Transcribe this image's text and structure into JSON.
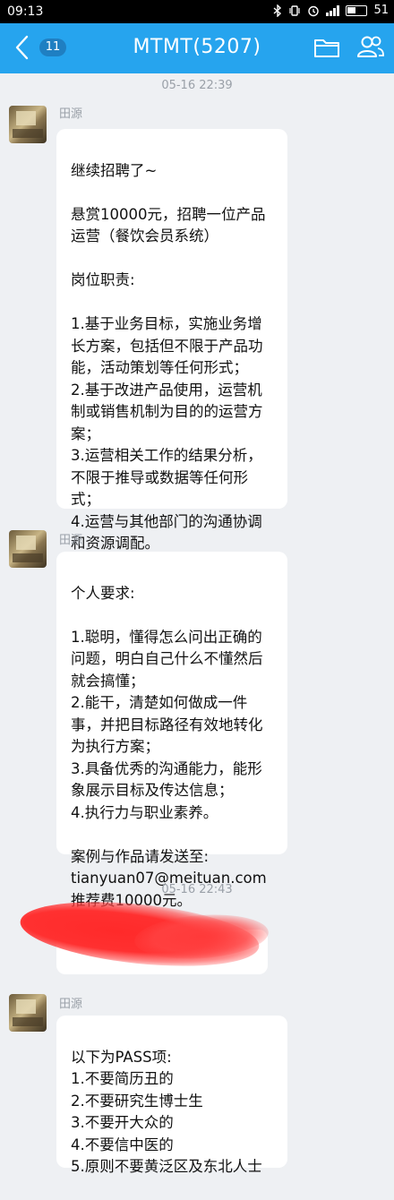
{
  "status_bar": {
    "time": "09:13",
    "battery": "51"
  },
  "header": {
    "back_badge": "11",
    "title": "MTMT(5207)",
    "folder_icon": "folder-icon",
    "members_icon": "people-icon",
    "accent": "#26a4ee"
  },
  "messages": [
    {
      "timestamp": "05-16 22:39"
    },
    {
      "sender": "田源",
      "text": "继续招聘了~\n\n悬赏10000元，招聘一位产品运营（餐饮会员系统）\n\n岗位职责:\n\n1.基于业务目标，实施业务增长方案，包括但不限于产品功能，活动策划等任何形式；\n2.基于改进产品使用，运营机制或销售机制为目的的运营方案；\n3.运营相关工作的结果分析，不限于推导或数据等任何形式；\n4.运营与其他部门的沟通协调和资源调配。"
    },
    {
      "sender": "田源",
      "text": "个人要求:\n\n1.聪明，懂得怎么问出正确的问题，明白自己什么不懂然后就会搞懂；\n2.能干，清楚如何做成一件事，并把目标路径有效地转化为执行方案；\n3.具备优秀的沟通能力，能形象展示目标及传达信息；\n4.执行力与职业素养。\n\n案例与作品请发送至:\ntianyuan07@meituan.com\n推荐费10000元。"
    },
    {
      "timestamp": "05-16 22:43"
    },
    {
      "sender": "田源",
      "text": "以下为PASS项:\n1.不要简历丑的\n2.不要研究生博士生\n3.不要开大众的\n4.不要信中医的\n5.原则不要黄泛区及东北人士"
    }
  ]
}
